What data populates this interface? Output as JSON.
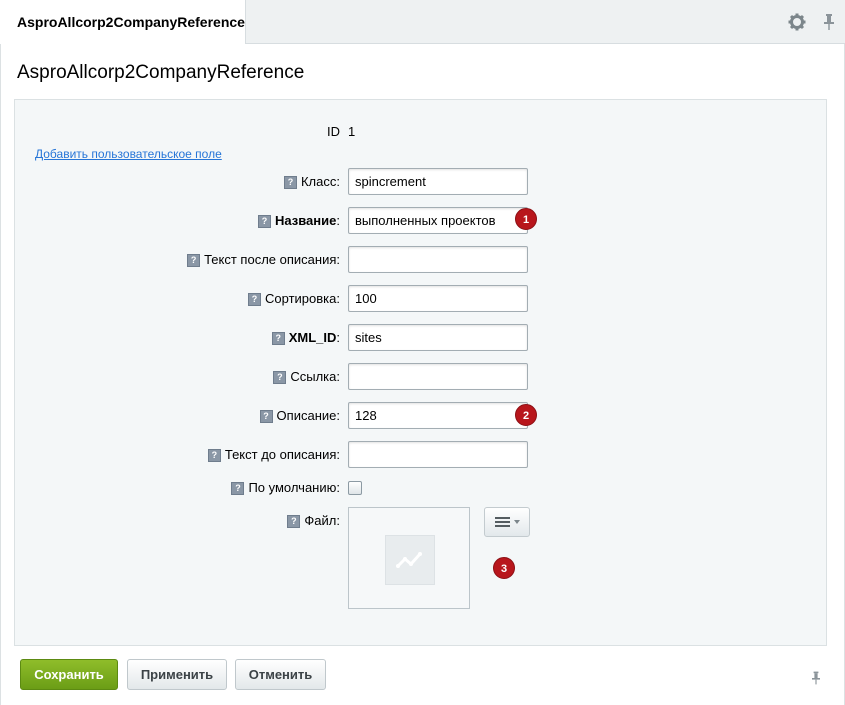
{
  "tab": {
    "label": "AsproAllcorp2CompanyReference"
  },
  "page": {
    "title": "AsproAllcorp2CompanyReference"
  },
  "form": {
    "id_label": "ID",
    "id_value": "1",
    "add_field_link": "Добавить пользовательское поле",
    "help_mark": "?",
    "fields": {
      "class": {
        "label": "Класс",
        "value": "spincrement"
      },
      "name": {
        "label": "Название",
        "value": "выполненных проектов"
      },
      "text_after": {
        "label": "Текст после описания",
        "value": ""
      },
      "sort": {
        "label": "Сортировка",
        "value": "100"
      },
      "xml_id": {
        "label": "XML_ID",
        "value": "sites"
      },
      "link": {
        "label": "Ссылка",
        "value": ""
      },
      "description": {
        "label": "Описание",
        "value": "128"
      },
      "text_before": {
        "label": "Текст до описания",
        "value": ""
      },
      "default": {
        "label": "По умолчанию",
        "checked": false
      },
      "file": {
        "label": "Файл"
      }
    },
    "colon": ":"
  },
  "badges": {
    "b1": "1",
    "b2": "2",
    "b3": "3"
  },
  "buttons": {
    "save": "Сохранить",
    "apply": "Применить",
    "cancel": "Отменить"
  },
  "icons": {
    "settings": "gear-icon",
    "pin": "pin-icon"
  },
  "colors": {
    "accent_green": "#7aab1f",
    "badge_red": "#b8161c",
    "link_blue": "#2675d7"
  }
}
